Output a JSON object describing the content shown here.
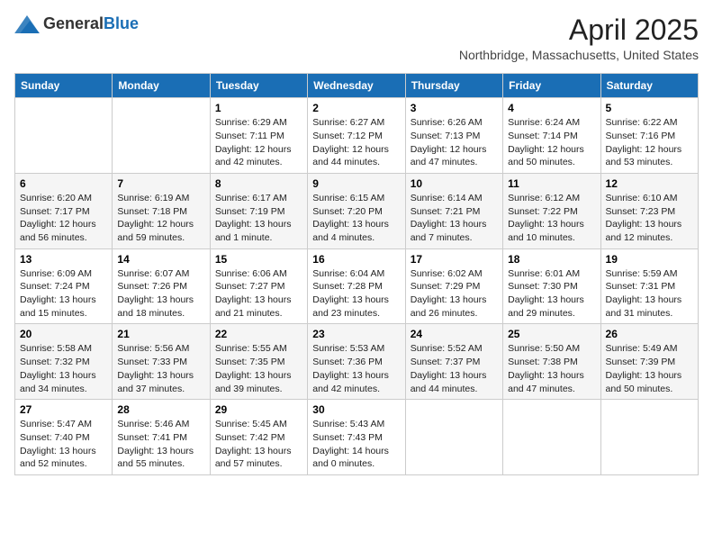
{
  "header": {
    "logo": {
      "general": "General",
      "blue": "Blue"
    },
    "month": "April 2025",
    "location": "Northbridge, Massachusetts, United States"
  },
  "days_of_week": [
    "Sunday",
    "Monday",
    "Tuesday",
    "Wednesday",
    "Thursday",
    "Friday",
    "Saturday"
  ],
  "weeks": [
    [
      {
        "day": "",
        "info": ""
      },
      {
        "day": "",
        "info": ""
      },
      {
        "day": "1",
        "info": "Sunrise: 6:29 AM\nSunset: 7:11 PM\nDaylight: 12 hours\nand 42 minutes."
      },
      {
        "day": "2",
        "info": "Sunrise: 6:27 AM\nSunset: 7:12 PM\nDaylight: 12 hours\nand 44 minutes."
      },
      {
        "day": "3",
        "info": "Sunrise: 6:26 AM\nSunset: 7:13 PM\nDaylight: 12 hours\nand 47 minutes."
      },
      {
        "day": "4",
        "info": "Sunrise: 6:24 AM\nSunset: 7:14 PM\nDaylight: 12 hours\nand 50 minutes."
      },
      {
        "day": "5",
        "info": "Sunrise: 6:22 AM\nSunset: 7:16 PM\nDaylight: 12 hours\nand 53 minutes."
      }
    ],
    [
      {
        "day": "6",
        "info": "Sunrise: 6:20 AM\nSunset: 7:17 PM\nDaylight: 12 hours\nand 56 minutes."
      },
      {
        "day": "7",
        "info": "Sunrise: 6:19 AM\nSunset: 7:18 PM\nDaylight: 12 hours\nand 59 minutes."
      },
      {
        "day": "8",
        "info": "Sunrise: 6:17 AM\nSunset: 7:19 PM\nDaylight: 13 hours\nand 1 minute."
      },
      {
        "day": "9",
        "info": "Sunrise: 6:15 AM\nSunset: 7:20 PM\nDaylight: 13 hours\nand 4 minutes."
      },
      {
        "day": "10",
        "info": "Sunrise: 6:14 AM\nSunset: 7:21 PM\nDaylight: 13 hours\nand 7 minutes."
      },
      {
        "day": "11",
        "info": "Sunrise: 6:12 AM\nSunset: 7:22 PM\nDaylight: 13 hours\nand 10 minutes."
      },
      {
        "day": "12",
        "info": "Sunrise: 6:10 AM\nSunset: 7:23 PM\nDaylight: 13 hours\nand 12 minutes."
      }
    ],
    [
      {
        "day": "13",
        "info": "Sunrise: 6:09 AM\nSunset: 7:24 PM\nDaylight: 13 hours\nand 15 minutes."
      },
      {
        "day": "14",
        "info": "Sunrise: 6:07 AM\nSunset: 7:26 PM\nDaylight: 13 hours\nand 18 minutes."
      },
      {
        "day": "15",
        "info": "Sunrise: 6:06 AM\nSunset: 7:27 PM\nDaylight: 13 hours\nand 21 minutes."
      },
      {
        "day": "16",
        "info": "Sunrise: 6:04 AM\nSunset: 7:28 PM\nDaylight: 13 hours\nand 23 minutes."
      },
      {
        "day": "17",
        "info": "Sunrise: 6:02 AM\nSunset: 7:29 PM\nDaylight: 13 hours\nand 26 minutes."
      },
      {
        "day": "18",
        "info": "Sunrise: 6:01 AM\nSunset: 7:30 PM\nDaylight: 13 hours\nand 29 minutes."
      },
      {
        "day": "19",
        "info": "Sunrise: 5:59 AM\nSunset: 7:31 PM\nDaylight: 13 hours\nand 31 minutes."
      }
    ],
    [
      {
        "day": "20",
        "info": "Sunrise: 5:58 AM\nSunset: 7:32 PM\nDaylight: 13 hours\nand 34 minutes."
      },
      {
        "day": "21",
        "info": "Sunrise: 5:56 AM\nSunset: 7:33 PM\nDaylight: 13 hours\nand 37 minutes."
      },
      {
        "day": "22",
        "info": "Sunrise: 5:55 AM\nSunset: 7:35 PM\nDaylight: 13 hours\nand 39 minutes."
      },
      {
        "day": "23",
        "info": "Sunrise: 5:53 AM\nSunset: 7:36 PM\nDaylight: 13 hours\nand 42 minutes."
      },
      {
        "day": "24",
        "info": "Sunrise: 5:52 AM\nSunset: 7:37 PM\nDaylight: 13 hours\nand 44 minutes."
      },
      {
        "day": "25",
        "info": "Sunrise: 5:50 AM\nSunset: 7:38 PM\nDaylight: 13 hours\nand 47 minutes."
      },
      {
        "day": "26",
        "info": "Sunrise: 5:49 AM\nSunset: 7:39 PM\nDaylight: 13 hours\nand 50 minutes."
      }
    ],
    [
      {
        "day": "27",
        "info": "Sunrise: 5:47 AM\nSunset: 7:40 PM\nDaylight: 13 hours\nand 52 minutes."
      },
      {
        "day": "28",
        "info": "Sunrise: 5:46 AM\nSunset: 7:41 PM\nDaylight: 13 hours\nand 55 minutes."
      },
      {
        "day": "29",
        "info": "Sunrise: 5:45 AM\nSunset: 7:42 PM\nDaylight: 13 hours\nand 57 minutes."
      },
      {
        "day": "30",
        "info": "Sunrise: 5:43 AM\nSunset: 7:43 PM\nDaylight: 14 hours\nand 0 minutes."
      },
      {
        "day": "",
        "info": ""
      },
      {
        "day": "",
        "info": ""
      },
      {
        "day": "",
        "info": ""
      }
    ]
  ]
}
